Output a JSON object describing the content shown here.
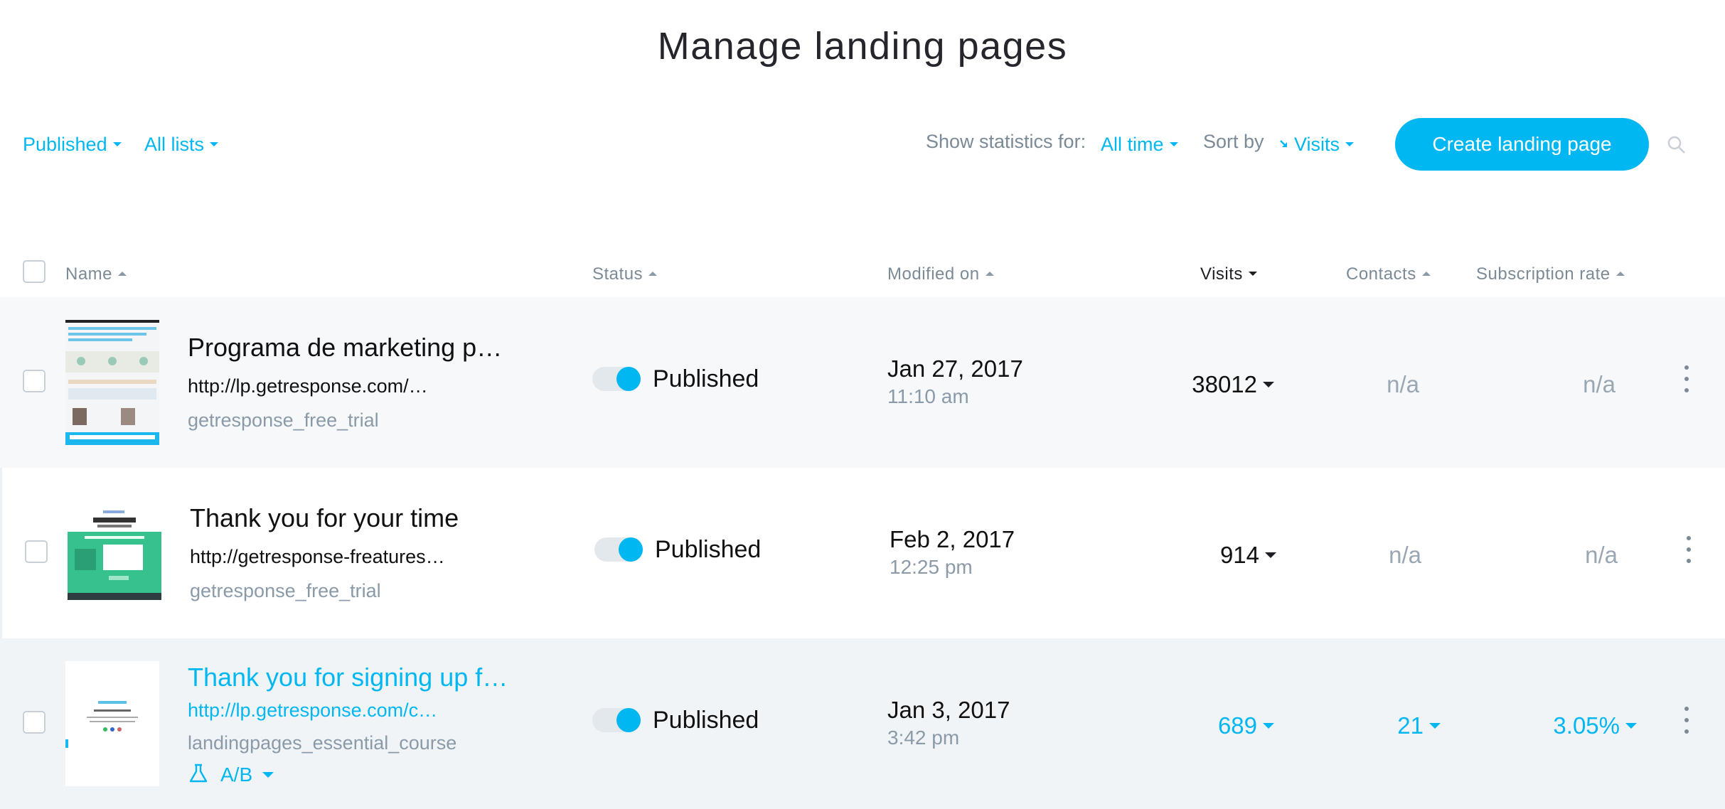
{
  "page": {
    "title": "Manage landing pages"
  },
  "filters": {
    "status_filter": "Published",
    "lists_filter": "All lists",
    "show_statistics_label": "Show statistics for:",
    "statistics_period": "All time",
    "sort_by_label": "Sort by",
    "sort_by_value": "Visits",
    "create_button": "Create landing page"
  },
  "table": {
    "columns": {
      "name": "Name",
      "status": "Status",
      "modified_on": "Modified on",
      "visits": "Visits",
      "contacts": "Contacts",
      "subscription_rate": "Subscription rate"
    },
    "rows": [
      {
        "name": "Programa de marketing p…",
        "url": "http://lp.getresponse.com/…",
        "list": "getresponse_free_trial",
        "status": "Published",
        "date": "Jan 27, 2017",
        "time": "11:10 am",
        "visits": "38012",
        "contacts": "n/a",
        "subscription_rate": "n/a"
      },
      {
        "name": "Thank you for your time",
        "url": "http://getresponse-freatures…",
        "list": "getresponse_free_trial",
        "status": "Published",
        "date": "Feb 2, 2017",
        "time": "12:25 pm",
        "visits": "914",
        "contacts": "n/a",
        "subscription_rate": "n/a"
      },
      {
        "name": "Thank you for signing up f…",
        "url": "http://lp.getresponse.com/c…",
        "list": "landingpages_essential_course",
        "ab_label": "A/B",
        "status": "Published",
        "date": "Jan 3, 2017",
        "time": "3:42 pm",
        "visits": "689",
        "contacts": "21",
        "subscription_rate": "3.05%"
      }
    ]
  },
  "colors": {
    "accent": "#00b7f1",
    "muted": "#7b8a97",
    "text": "#111111"
  }
}
